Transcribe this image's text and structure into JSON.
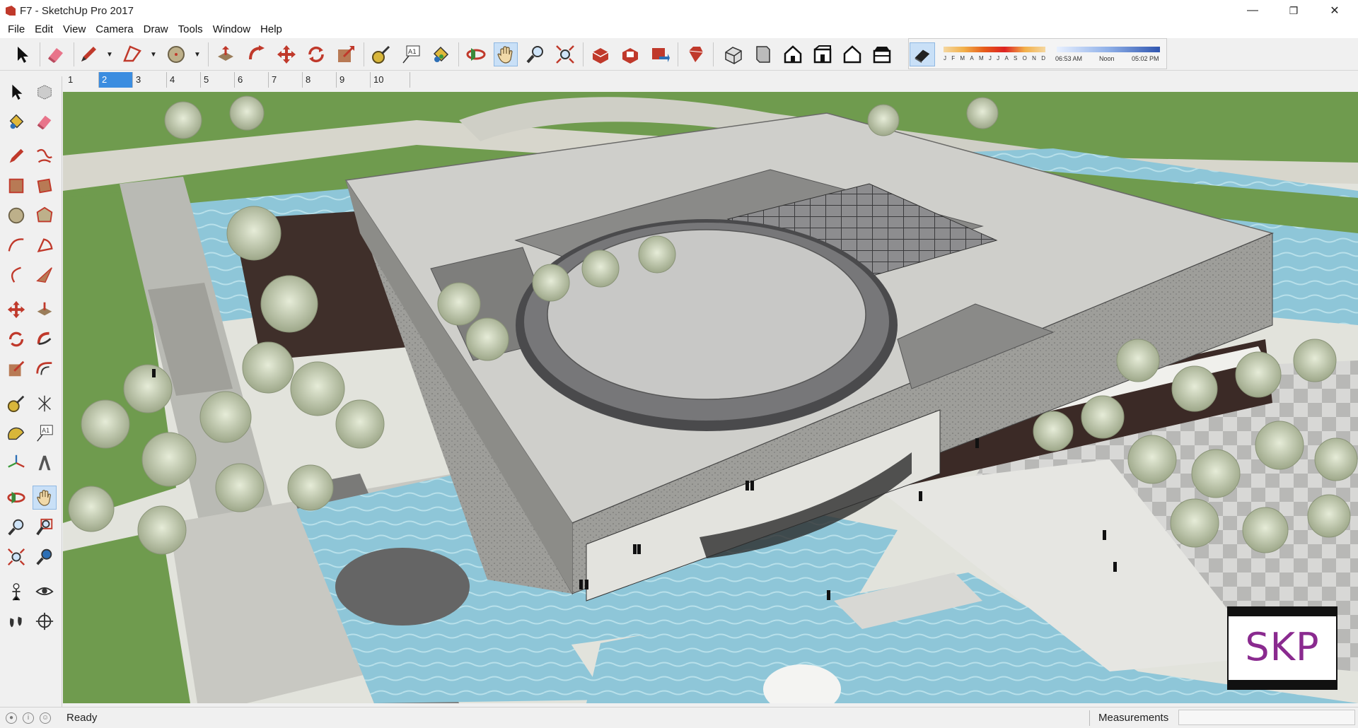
{
  "window": {
    "title": "F7 - SketchUp Pro 2017",
    "minimize_glyph": "—",
    "restore_glyph": "❐",
    "close_glyph": "✕"
  },
  "menu": [
    "File",
    "Edit",
    "View",
    "Camera",
    "Draw",
    "Tools",
    "Window",
    "Help"
  ],
  "toolbar_icons": [
    "select-icon",
    "eraser-icon",
    "pencil-icon",
    "freehand-icon",
    "circle-icon",
    "push-pull-icon",
    "follow-me-icon",
    "move-icon",
    "rotate-icon",
    "scale-icon",
    "tape-measure-icon",
    "text-icon",
    "paint-bucket-icon",
    "orbit-icon",
    "pan-icon",
    "zoom-icon",
    "zoom-extents-icon",
    "warehouse-icon",
    "extension-warehouse-icon",
    "share-model-icon",
    "ruby-icon",
    "iso-view-icon",
    "top-view-icon",
    "front-view-icon",
    "right-view-icon",
    "back-view-icon",
    "left-view-icon",
    "shadow-toggle-icon"
  ],
  "shadow": {
    "months": [
      "J",
      "F",
      "M",
      "A",
      "M",
      "J",
      "J",
      "A",
      "S",
      "O",
      "N",
      "D"
    ],
    "time_start": "06:53 AM",
    "time_mid": "Noon",
    "time_end": "05:02 PM"
  },
  "scenes": {
    "tabs": [
      "1",
      "2",
      "3",
      "4",
      "5",
      "6",
      "7",
      "8",
      "9",
      "10"
    ],
    "active_index": 1
  },
  "left_toolbar_icons": [
    "select-icon",
    "component-icon",
    "paint-bucket-icon",
    "eraser-icon",
    "pencil-icon",
    "freehand-icon",
    "rectangle-icon",
    "rotated-rectangle-icon",
    "circle-icon",
    "polygon-icon",
    "arc-icon",
    "pie-icon",
    "two-point-arc-icon",
    "three-point-arc-icon",
    "move-icon",
    "push-pull-icon",
    "rotate-icon",
    "follow-me-icon",
    "scale-icon",
    "offset-icon",
    "tape-measure-icon",
    "axes-icon",
    "protractor-icon",
    "text-icon",
    "axes-tool-icon",
    "3d-text-icon",
    "orbit-icon",
    "pan-icon",
    "zoom-icon",
    "zoom-window-icon",
    "zoom-extents-icon",
    "previous-view-icon",
    "position-camera-icon",
    "look-around-icon",
    "walk-icon",
    "section-plane-icon"
  ],
  "watermark": "SKP",
  "status": {
    "text": "Ready",
    "measurements_label": "Measurements",
    "measurements_value": ""
  },
  "colors": {
    "accent": "#3b8de0",
    "water": "#8ec6d8",
    "grass": "#6d9a4a",
    "building": "#cfcfcb",
    "watermark": "#8a2a8f"
  }
}
